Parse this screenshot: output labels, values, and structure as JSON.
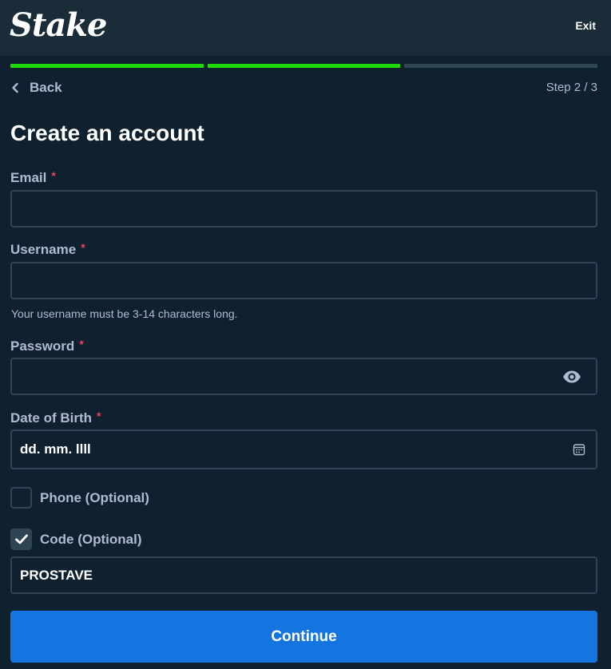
{
  "brand": {
    "logo_text": "Stake"
  },
  "header": {
    "exit_label": "Exit"
  },
  "progress": {
    "steps_total": 3,
    "steps_completed": 2,
    "done_color": "#1fdc05",
    "todo_color": "#2f4553"
  },
  "nav": {
    "back_label": "Back",
    "step_text": "Step 2 / 3"
  },
  "form": {
    "title": "Create an account",
    "required_marker": "*",
    "email": {
      "label": "Email",
      "value": ""
    },
    "username": {
      "label": "Username",
      "value": "",
      "hint": "Your username must be 3-14 characters long."
    },
    "password": {
      "label": "Password",
      "value": "",
      "toggle_icon": "eye-icon"
    },
    "dob": {
      "label": "Date of Birth",
      "placeholder": "dd. mm. llll",
      "value": "",
      "icon": "calendar-icon"
    },
    "phone": {
      "label": "Phone (Optional)",
      "checked": false
    },
    "code": {
      "label": "Code (Optional)",
      "checked": true,
      "value": "PROSTAVE"
    },
    "submit_label": "Continue"
  },
  "colors": {
    "background": "#0f212e",
    "topbar": "#1a2c38",
    "border": "#2f4553",
    "text_muted": "#b1bad3",
    "required": "#ed4163",
    "primary_button": "#1475e1"
  }
}
